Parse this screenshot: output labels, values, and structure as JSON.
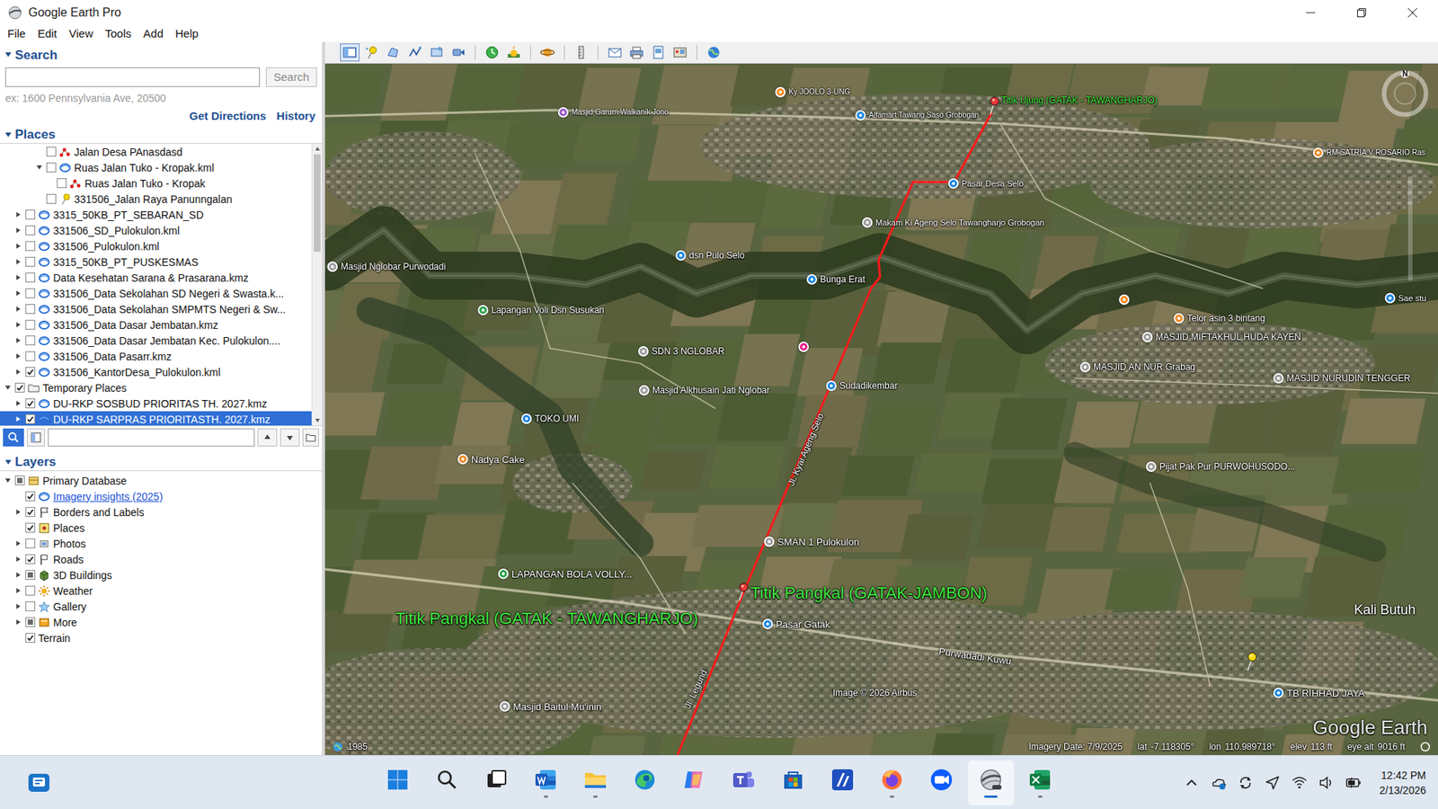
{
  "window": {
    "title": "Google Earth Pro"
  },
  "menu": [
    "File",
    "Edit",
    "View",
    "Tools",
    "Add",
    "Help"
  ],
  "toolbar": [
    {
      "kind": "sidebar",
      "selected": true
    },
    {
      "kind": "placemark",
      "selected": false
    },
    {
      "kind": "polygon",
      "selected": false
    },
    {
      "kind": "path",
      "selected": false
    },
    {
      "kind": "overlay",
      "selected": false
    },
    {
      "kind": "tour",
      "selected": false
    },
    {
      "kind": "history",
      "selected": false
    },
    {
      "kind": "sun",
      "selected": false
    },
    {
      "kind": "planets",
      "selected": false
    },
    {
      "kind": "ruler",
      "selected": false
    },
    {
      "kind": "email",
      "selected": false
    },
    {
      "kind": "print",
      "selected": false
    },
    {
      "kind": "save-image",
      "selected": false
    },
    {
      "kind": "map",
      "selected": false
    },
    {
      "kind": "web",
      "selected": false
    }
  ],
  "search": {
    "title": "Search",
    "expanded": true,
    "value": "",
    "button": "Search",
    "hint": "ex: 1600 Pennsylvania Ave, 20500",
    "links": [
      "Get Directions",
      "History"
    ]
  },
  "places": {
    "title": "Places",
    "expanded": true,
    "filter_value": "",
    "items": [
      {
        "label": "Jalan Desa PAnasdasd",
        "level": 3,
        "expandable": false,
        "expanded": false,
        "checked": false,
        "partial": false,
        "kind": "path",
        "selected": false
      },
      {
        "label": "Ruas Jalan Tuko - Kropak.kml",
        "level": 3,
        "expandable": true,
        "expanded": true,
        "checked": false,
        "partial": false,
        "kind": "kml",
        "selected": false
      },
      {
        "label": "Ruas Jalan Tuko - Kropak",
        "level": 4,
        "expandable": false,
        "expanded": false,
        "checked": false,
        "partial": false,
        "kind": "path",
        "selected": false
      },
      {
        "label": "331506_Jalan Raya Panunngalan",
        "level": 3,
        "expandable": false,
        "expanded": false,
        "checked": false,
        "partial": false,
        "kind": "pin",
        "selected": false
      },
      {
        "label": "3315_50KB_PT_SEBARAN_SD",
        "level": 1,
        "expandable": true,
        "expanded": false,
        "checked": false,
        "partial": false,
        "kind": "kml",
        "selected": false
      },
      {
        "label": "331506_SD_Pulokulon.kml",
        "level": 1,
        "expandable": true,
        "expanded": false,
        "checked": false,
        "partial": false,
        "kind": "kml",
        "selected": false
      },
      {
        "label": "331506_Pulokulon.kml",
        "level": 1,
        "expandable": true,
        "expanded": false,
        "checked": false,
        "partial": false,
        "kind": "kml",
        "selected": false
      },
      {
        "label": "3315_50KB_PT_PUSKESMAS",
        "level": 1,
        "expandable": true,
        "expanded": false,
        "checked": false,
        "partial": false,
        "kind": "kml",
        "selected": false
      },
      {
        "label": "Data Kesehatan Sarana & Prasarana.kmz",
        "level": 1,
        "expandable": true,
        "expanded": false,
        "checked": false,
        "partial": false,
        "kind": "kml",
        "selected": false
      },
      {
        "label": "331506_Data Sekolahan SD Negeri & Swasta.k...",
        "level": 1,
        "expandable": true,
        "expanded": false,
        "checked": false,
        "partial": false,
        "kind": "kml",
        "selected": false
      },
      {
        "label": "331506_Data Sekolahan SMPMTS Negeri & Sw...",
        "level": 1,
        "expandable": true,
        "expanded": false,
        "checked": false,
        "partial": false,
        "kind": "kml",
        "selected": false
      },
      {
        "label": "331506_Data Dasar Jembatan.kmz",
        "level": 1,
        "expandable": true,
        "expanded": false,
        "checked": false,
        "partial": false,
        "kind": "kml",
        "selected": false
      },
      {
        "label": "331506_Data Dasar Jembatan Kec. Pulokulon....",
        "level": 1,
        "expandable": true,
        "expanded": false,
        "checked": false,
        "partial": false,
        "kind": "kml",
        "selected": false
      },
      {
        "label": "331506_Data Pasarr.kmz",
        "level": 1,
        "expandable": true,
        "expanded": false,
        "checked": false,
        "partial": false,
        "kind": "kml",
        "selected": false
      },
      {
        "label": "331506_KantorDesa_Pulokulon.kml",
        "level": 1,
        "expandable": true,
        "expanded": false,
        "checked": true,
        "partial": false,
        "kind": "kml",
        "selected": false
      },
      {
        "label": "Temporary Places",
        "level": 0,
        "expandable": true,
        "expanded": true,
        "checked": true,
        "partial": false,
        "kind": "folder",
        "selected": false
      },
      {
        "label": "DU-RKP SOSBUD PRIORITAS TH. 2027.kmz",
        "level": 1,
        "expandable": true,
        "expanded": false,
        "checked": true,
        "partial": false,
        "kind": "kml",
        "selected": false
      },
      {
        "label": "DU-RKP SARPRAS PRIORITASTH. 2027.kmz",
        "level": 1,
        "expandable": true,
        "expanded": false,
        "checked": true,
        "partial": false,
        "kind": "kml",
        "selected": true
      }
    ]
  },
  "layers": {
    "title": "Layers",
    "expanded": true,
    "items": [
      {
        "label": "Primary Database",
        "level": 0,
        "expandable": true,
        "expanded": true,
        "checked": false,
        "partial": true,
        "kind": "database",
        "link": false
      },
      {
        "label": "Imagery insights (2025)",
        "level": 1,
        "expandable": false,
        "expanded": false,
        "checked": true,
        "partial": false,
        "kind": "imagery",
        "link": true
      },
      {
        "label": "Borders and Labels",
        "level": 1,
        "expandable": true,
        "expanded": false,
        "checked": true,
        "partial": false,
        "kind": "borders",
        "link": false
      },
      {
        "label": "Places",
        "level": 1,
        "expandable": false,
        "expanded": false,
        "checked": true,
        "partial": false,
        "kind": "places",
        "link": false
      },
      {
        "label": "Photos",
        "level": 1,
        "expandable": true,
        "expanded": false,
        "checked": false,
        "partial": false,
        "kind": "photos",
        "link": false
      },
      {
        "label": "Roads",
        "level": 1,
        "expandable": true,
        "expanded": false,
        "checked": true,
        "partial": false,
        "kind": "roads",
        "link": false
      },
      {
        "label": "3D Buildings",
        "level": 1,
        "expandable": true,
        "expanded": false,
        "checked": false,
        "partial": true,
        "kind": "buildings",
        "link": false
      },
      {
        "label": "Weather",
        "level": 1,
        "expandable": true,
        "expanded": false,
        "checked": false,
        "partial": false,
        "kind": "weather",
        "link": false
      },
      {
        "label": "Gallery",
        "level": 1,
        "expandable": true,
        "expanded": false,
        "checked": false,
        "partial": false,
        "kind": "gallery",
        "link": false
      },
      {
        "label": "More",
        "level": 1,
        "expandable": true,
        "expanded": false,
        "checked": false,
        "partial": true,
        "kind": "more",
        "link": false
      },
      {
        "label": "Terrain",
        "level": 1,
        "expandable": false,
        "expanded": false,
        "checked": true,
        "partial": false,
        "kind": "none",
        "link": false
      }
    ]
  },
  "map": {
    "compass": "N",
    "watermark": "Google Earth",
    "route": {
      "color": "#ff1a1a"
    },
    "labels": [
      {
        "label": "Ky JOOLO 3-UNG",
        "kind": "pin",
        "color": "#f28c28"
      },
      {
        "label": "Masjid Garum Walkanik Jono",
        "kind": "pin",
        "color": "#9b59d0"
      },
      {
        "label": "Alfamart Tawang Saso Grobogan",
        "kind": "pin",
        "color": "#1e88e5"
      },
      {
        "label": "Titik Ujung (GATAK - TAWANGHARJO)",
        "kind": "route-end",
        "color": "#e53935"
      },
      {
        "label": "RM SATRIA V ROSARIO Ras",
        "kind": "pin",
        "color": "#f28c28"
      },
      {
        "label": "Pasar Desa Selo",
        "kind": "pin",
        "color": "#1e88e5"
      },
      {
        "label": "Makam Ki Ageng Selo Tawangharjo Grobogan",
        "kind": "pin",
        "color": "#9e9e9e"
      },
      {
        "label": "Masjid Nglobar Purwodadi",
        "kind": "pin",
        "color": "#9e9e9e"
      },
      {
        "label": "dsn Pulo Selo",
        "kind": "pin",
        "color": "#1e88e5"
      },
      {
        "label": "Bunga Erat",
        "kind": "pin",
        "color": "#1e88e5"
      },
      {
        "label": "Sae stu",
        "kind": "pin",
        "color": "#1e88e5"
      },
      {
        "label": "Lapangan Voli Dsn Susukan",
        "kind": "pin",
        "color": "#2fa84f"
      },
      {
        "label": "",
        "kind": "pin",
        "color": "#f28c28"
      },
      {
        "label": "Telor asin 3 bintang",
        "kind": "pin",
        "color": "#f28c28"
      },
      {
        "label": "MASJID MIFTAKHUL HUDA KAYEN",
        "kind": "pin",
        "color": "#9e9e9e"
      },
      {
        "label": "SDN 3 NGLOBAR",
        "kind": "pin",
        "color": "#9e9e9e"
      },
      {
        "label": "",
        "kind": "pin",
        "color": "#e91e8c"
      },
      {
        "label": "MASJID AN NUR Grabag",
        "kind": "pin",
        "color": "#9e9e9e"
      },
      {
        "label": "MASJID NURUDIN TENGGER",
        "kind": "pin",
        "color": "#9e9e9e"
      },
      {
        "label": "Masjid Alkhusain Jati Nglobar",
        "kind": "pin",
        "color": "#9e9e9e"
      },
      {
        "label": "Sudadikembar",
        "kind": "pin",
        "color": "#1e88e5"
      },
      {
        "label": "TOKO UMI",
        "kind": "pin",
        "color": "#1e88e5"
      },
      {
        "label": "Nadya Cake",
        "kind": "pin",
        "color": "#f28c28"
      },
      {
        "label": "Pijat Pak Pur PURWOHUSODO...",
        "kind": "pin",
        "color": "#9e9e9e"
      },
      {
        "label": "SMAN 1 Pulokulon",
        "kind": "pin",
        "color": "#9e9e9e"
      },
      {
        "label": "LAPANGAN BOLA VOLLY...",
        "kind": "pin",
        "color": "#2fa84f"
      },
      {
        "label": "Pasar Gatak",
        "kind": "pin",
        "color": "#1e88e5"
      },
      {
        "label": "Masjid Baitul Mu'inin",
        "kind": "pin",
        "color": "#9e9e9e"
      },
      {
        "label": "TB RIHHAD JAYA",
        "kind": "pin",
        "color": "#1e88e5"
      },
      {
        "label": "Titik Pangkal (GATAK - TAWANGHARJO)",
        "kind": "title"
      },
      {
        "label": "Titik Pangkal (GATAK-JAMBON)",
        "kind": "route-start",
        "color": "#e53935"
      },
      {
        "label": "",
        "kind": "pushpin",
        "color": "#f5d90a"
      },
      {
        "label": "Kali Butuh",
        "kind": "text"
      },
      {
        "label": "Image © 2026 Airbus",
        "kind": "credit"
      },
      {
        "label": "Jl. Kyai Ageng Selo",
        "kind": "road"
      },
      {
        "label": "Purwadadi Kuwu",
        "kind": "road"
      },
      {
        "label": "Jl. Legund",
        "kind": "road"
      }
    ]
  },
  "status_bar": {
    "year": "1985",
    "imagery_date": "Imagery Date: 7/9/2025",
    "lat_label": "lat",
    "lat": "-7.118305°",
    "lon_label": "lon",
    "lon": "110.989718°",
    "elev_label": "elev",
    "elev": "113 ft",
    "eye_label": "eye alt",
    "eye": "9016 ft"
  },
  "taskbar": {
    "widget": {
      "kind": "widgets"
    },
    "apps": [
      {
        "kind": "start",
        "running": false,
        "active": false
      },
      {
        "kind": "search",
        "running": false,
        "active": false
      },
      {
        "kind": "taskview",
        "running": false,
        "active": false
      },
      {
        "kind": "word",
        "running": true,
        "active": false
      },
      {
        "kind": "explorer",
        "running": true,
        "active": false
      },
      {
        "kind": "edge",
        "running": false,
        "active": false
      },
      {
        "kind": "copilot",
        "running": false,
        "active": false
      },
      {
        "kind": "teams",
        "running": false,
        "active": false
      },
      {
        "kind": "store",
        "running": false,
        "active": false
      },
      {
        "kind": "app-a",
        "running": false,
        "active": false
      },
      {
        "kind": "firefox",
        "running": true,
        "active": false
      },
      {
        "kind": "zoom",
        "running": false,
        "active": false
      },
      {
        "kind": "earth",
        "running": true,
        "active": true
      },
      {
        "kind": "excel",
        "running": true,
        "active": false
      }
    ],
    "tray": [
      {
        "kind": "chevron"
      },
      {
        "kind": "onedrive"
      },
      {
        "kind": "sync"
      },
      {
        "kind": "location"
      },
      {
        "kind": "wifi"
      },
      {
        "kind": "volume"
      },
      {
        "kind": "battery"
      }
    ],
    "time": "12:42 PM",
    "date": "2/13/2026"
  }
}
